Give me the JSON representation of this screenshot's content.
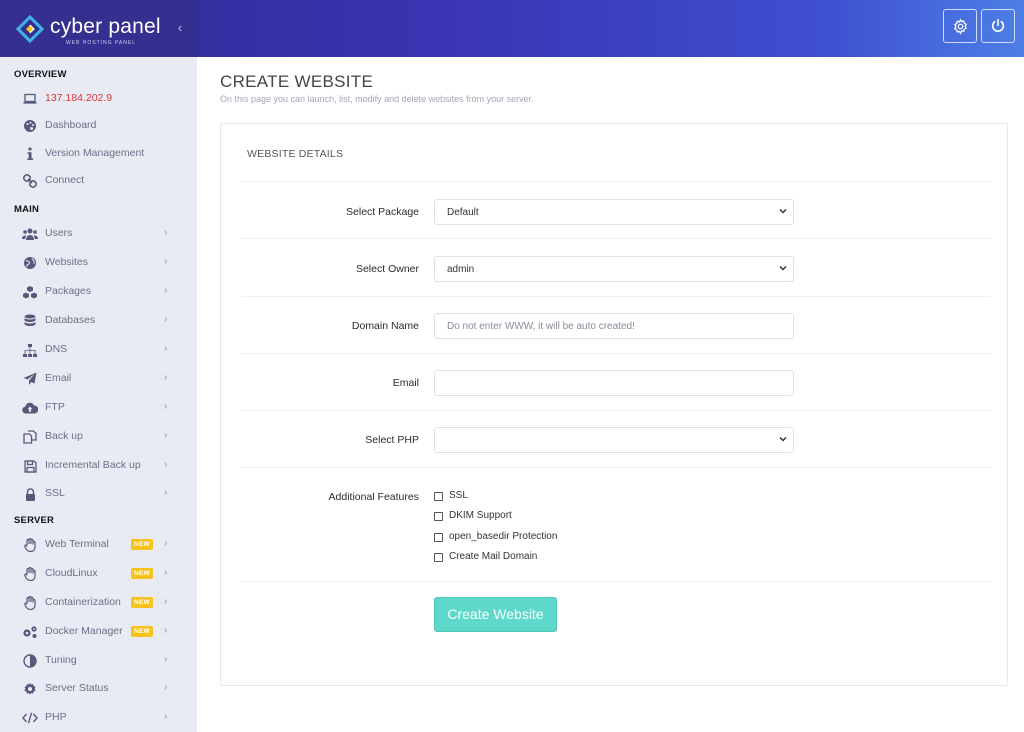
{
  "brand": {
    "name": "cyber panel",
    "tagline": "WEB HOSTING PANEL"
  },
  "header": {
    "settings_icon": "gear-icon",
    "power_icon": "power-icon"
  },
  "sidebar": {
    "sections": {
      "overview": "OVERVIEW",
      "main": "MAIN",
      "server": "SERVER"
    },
    "overview_items": [
      {
        "label": "137.184.202.9",
        "icon": "laptop-icon"
      },
      {
        "label": "Dashboard",
        "icon": "palette-icon"
      },
      {
        "label": "Version Management",
        "icon": "info-icon"
      },
      {
        "label": "Connect",
        "icon": "link-icon"
      }
    ],
    "main_items": [
      {
        "label": "Users",
        "icon": "users-icon"
      },
      {
        "label": "Websites",
        "icon": "globe-icon"
      },
      {
        "label": "Packages",
        "icon": "cubes-icon"
      },
      {
        "label": "Databases",
        "icon": "database-icon"
      },
      {
        "label": "DNS",
        "icon": "sitemap-icon"
      },
      {
        "label": "Email",
        "icon": "paper-plane-icon"
      },
      {
        "label": "FTP",
        "icon": "cloud-upload-icon"
      },
      {
        "label": "Back up",
        "icon": "copy-icon"
      },
      {
        "label": "Incremental Back up",
        "icon": "save-icon"
      },
      {
        "label": "SSL",
        "icon": "lock-icon"
      }
    ],
    "server_items": [
      {
        "label": "Web Terminal",
        "icon": "hand-icon",
        "badge": "NEW"
      },
      {
        "label": "CloudLinux",
        "icon": "hand-icon",
        "badge": "NEW"
      },
      {
        "label": "Containerization",
        "icon": "hand-icon",
        "badge": "NEW"
      },
      {
        "label": "Docker Manager",
        "icon": "cogs-icon",
        "badge": "NEW"
      },
      {
        "label": "Tuning",
        "icon": "adjust-icon"
      },
      {
        "label": "Server Status",
        "icon": "cog-icon"
      },
      {
        "label": "PHP",
        "icon": "code-icon"
      }
    ]
  },
  "page": {
    "title": "CREATE WEBSITE",
    "subtitle": "On this page you can launch, list, modify and delete websites from your server."
  },
  "form": {
    "section_title": "WEBSITE DETAILS",
    "package": {
      "label": "Select Package",
      "value": "Default"
    },
    "owner": {
      "label": "Select Owner",
      "value": "admin"
    },
    "domain": {
      "label": "Domain Name",
      "value": "",
      "placeholder": "Do not enter WWW, it will be auto created!"
    },
    "email": {
      "label": "Email",
      "value": "",
      "placeholder": ""
    },
    "php": {
      "label": "Select PHP",
      "value": ""
    },
    "features": {
      "label": "Additional Features",
      "options": [
        {
          "label": "SSL",
          "checked": false
        },
        {
          "label": "DKIM Support",
          "checked": false
        },
        {
          "label": "open_basedir Protection",
          "checked": false
        },
        {
          "label": "Create Mail Domain",
          "checked": false
        }
      ]
    },
    "submit_label": "Create Website"
  },
  "colors": {
    "header_dark": "#2b2a8f",
    "header_light": "#4d7ee6",
    "sidebar_bg": "#e9ebf4",
    "accent_button": "#5dd8c9",
    "ip_red": "#d9343a",
    "badge_yellow": "#f6c21b"
  }
}
